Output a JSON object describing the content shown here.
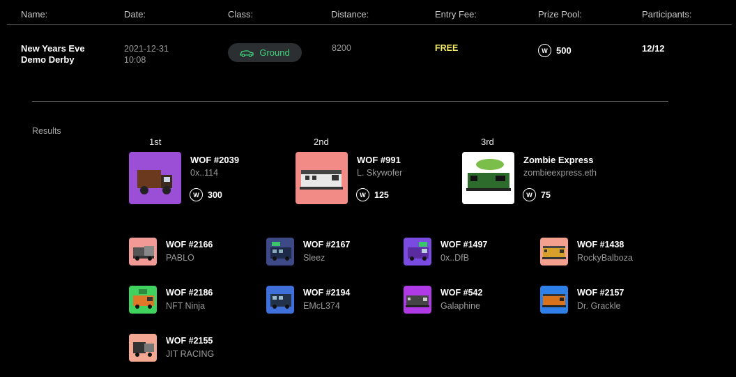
{
  "headers": {
    "name": "Name:",
    "date": "Date:",
    "class": "Class:",
    "distance": "Distance:",
    "entry_fee": "Entry Fee:",
    "prize_pool": "Prize Pool:",
    "participants": "Participants:"
  },
  "race": {
    "name_line1": "New Years Eve",
    "name_line2": "Demo Derby",
    "date_line1": "2021-12-31",
    "date_line2": "10:08",
    "class": "Ground",
    "class_icon": "car-icon",
    "distance": "8200",
    "entry_fee": "FREE",
    "prize_pool": "500",
    "participants": "12/12",
    "currency_icon": "w-coin-icon",
    "currency_glyph": "W"
  },
  "results_label": "Results",
  "podium": [
    {
      "place": "1st",
      "name": "WOF #2039",
      "owner": "0x..114",
      "prize": "300",
      "bg": "#9b4fd6",
      "vehicle": "box-truck"
    },
    {
      "place": "2nd",
      "name": "WOF #991",
      "owner": "L. Skywofer",
      "prize": "125",
      "bg": "#f28b86",
      "vehicle": "train"
    },
    {
      "place": "3rd",
      "name": "Zombie Express",
      "owner": "zombieexpress.eth",
      "prize": "75",
      "bg": "#ffffff",
      "vehicle": "green-train"
    }
  ],
  "others": [
    {
      "name": "WOF #2166",
      "owner": "PABLO",
      "bg": "#f29b96",
      "vehicle": "semi"
    },
    {
      "name": "WOF #2167",
      "owner": "Sleez",
      "bg": "#3e4a88",
      "vehicle": "bus"
    },
    {
      "name": "WOF #1497",
      "owner": "0x..DfB",
      "bg": "#7a4be0",
      "vehicle": "van"
    },
    {
      "name": "WOF #1438",
      "owner": "RockyBalboza",
      "bg": "#f4a08f",
      "vehicle": "train-yellow"
    },
    {
      "name": "WOF #2186",
      "owner": "NFT Ninja",
      "bg": "#3fd25f",
      "vehicle": "orange-van"
    },
    {
      "name": "WOF #2194",
      "owner": "EMcL374",
      "bg": "#3f6fd8",
      "vehicle": "bus-dark"
    },
    {
      "name": "WOF #542",
      "owner": "Galaphine",
      "bg": "#b03ae6",
      "vehicle": "train-dark"
    },
    {
      "name": "WOF #2157",
      "owner": "Dr. Grackle",
      "bg": "#2f7fe8",
      "vehicle": "train-orange"
    },
    {
      "name": "WOF #2155",
      "owner": "JIT RACING",
      "bg": "#f4a894",
      "vehicle": "semi-dark"
    }
  ]
}
